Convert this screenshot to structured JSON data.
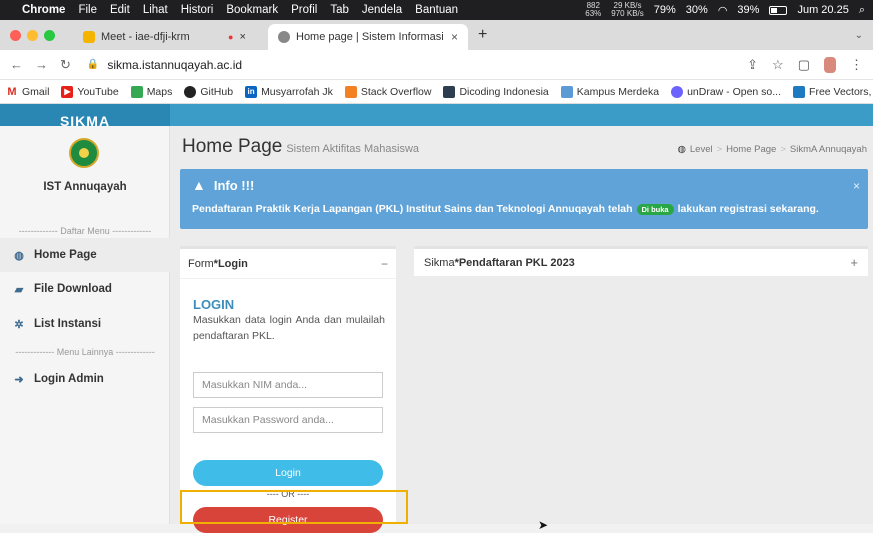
{
  "menubar": {
    "items": [
      "Chrome",
      "File",
      "Edit",
      "Lihat",
      "Histori",
      "Bookmark",
      "Profil",
      "Tab",
      "Jendela",
      "Bantuan"
    ],
    "stat_cpu_top": "882",
    "stat_cpu": "63%",
    "stat_net_top": "29 KB/s",
    "stat_net_bottom": "970 KB/s",
    "stat_mem": "79%",
    "stat_disk": "30%",
    "battery": "39%",
    "clock": "Jum 20.25"
  },
  "tabs": {
    "tab1_label": "Meet - iae-dfji-krm",
    "tab2_label": "Home page | Sistem Informasi",
    "tab2_close": "×",
    "new_tab": "+"
  },
  "address": {
    "url": "sikma.istannuqayah.ac.id"
  },
  "bookmarks": [
    "Gmail",
    "YouTube",
    "Maps",
    "GitHub",
    "Musyarrofah Jk",
    "Stack Overflow",
    "Dicoding Indonesia",
    "Kampus Merdeka",
    "unDraw - Open so...",
    "Free Vectors, Stoc..."
  ],
  "site": {
    "logo_text": "SIKMA"
  },
  "sidebar": {
    "title": "IST Annuqayah",
    "menu_divider": "------------- Daftar Menu -------------",
    "items": [
      "Home Page",
      "File Download",
      "List Instansi"
    ],
    "other_divider": "------------- Menu Lainnya -------------",
    "admin": "Login Admin"
  },
  "header": {
    "title": "Home Page",
    "subtitle": "Sistem Aktifitas Mahasiswa",
    "breadcrumb": [
      "Level",
      "Home Page",
      "SikmA Annuqayah"
    ]
  },
  "alert": {
    "title": "Info !!!",
    "text_before": "Pendaftaran Praktik Kerja Lapangan (PKL) Institut Sains dan Teknologi Annuqayah telah",
    "badge": "Di buka",
    "text_after": "lakukan registrasi sekarang.",
    "close": "×"
  },
  "login": {
    "box_title_prefix": "Form ",
    "box_title_bold": "*Login",
    "heading": "LOGIN",
    "description": "Masukkan data login Anda dan mulailah pendaftaran PKL.",
    "nim_placeholder": "Masukkan NIM anda...",
    "password_placeholder": "Masukkan Password anda...",
    "login_button": "Login",
    "or_text": "---- OR ----",
    "register_button": "Register"
  },
  "pkl": {
    "title_prefix": "Sikma ",
    "title_bold": "*Pendaftaran PKL 2023"
  }
}
